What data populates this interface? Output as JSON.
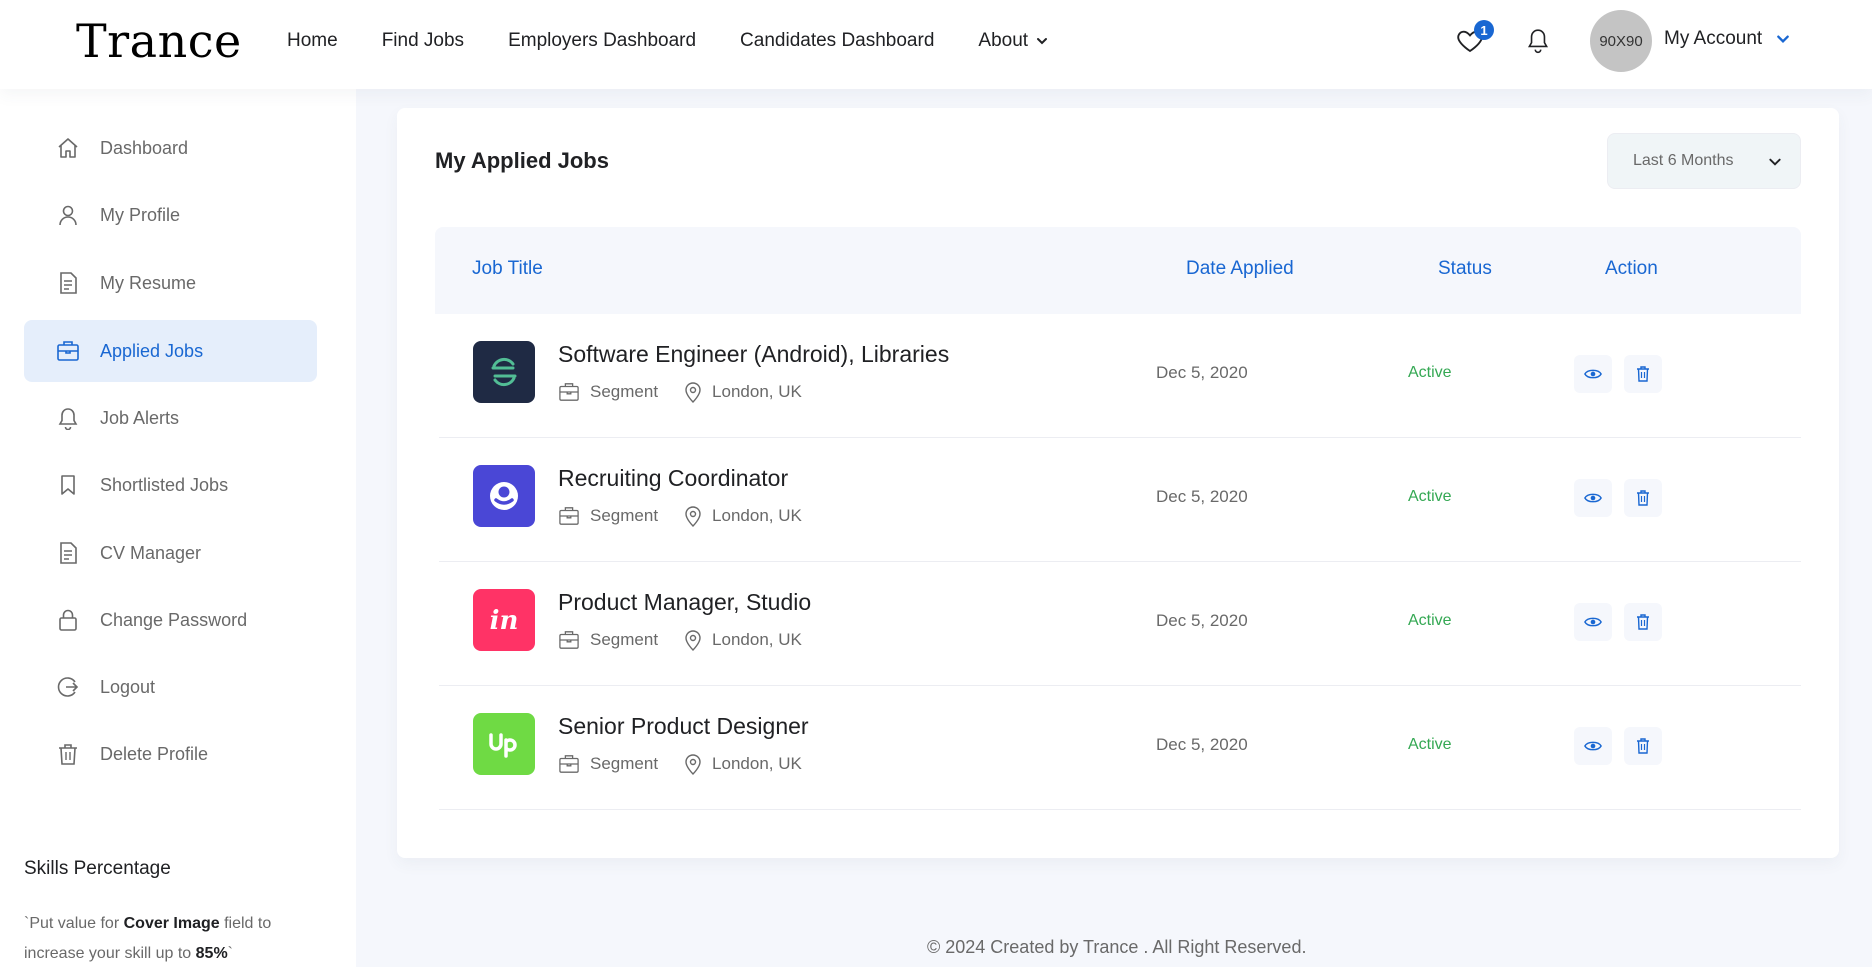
{
  "header": {
    "logo": "Trance",
    "nav": [
      {
        "label": "Home"
      },
      {
        "label": "Find Jobs"
      },
      {
        "label": "Employers Dashboard"
      },
      {
        "label": "Candidates Dashboard"
      },
      {
        "label": "About"
      }
    ],
    "wishlist_count": "1",
    "avatar_text": "90X90",
    "account_label": "My Account"
  },
  "sidebar": {
    "items": [
      {
        "label": "Dashboard",
        "icon": "home-icon"
      },
      {
        "label": "My Profile",
        "icon": "user-icon"
      },
      {
        "label": "My Resume",
        "icon": "document-icon"
      },
      {
        "label": "Applied Jobs",
        "icon": "briefcase-icon",
        "active": true
      },
      {
        "label": "Job Alerts",
        "icon": "bell-icon"
      },
      {
        "label": "Shortlisted Jobs",
        "icon": "bookmark-icon"
      },
      {
        "label": "CV Manager",
        "icon": "document-icon"
      },
      {
        "label": "Change Password",
        "icon": "lock-icon"
      },
      {
        "label": "Logout",
        "icon": "logout-icon"
      },
      {
        "label": "Delete Profile",
        "icon": "trash-icon"
      }
    ],
    "skills_title": "Skills Percentage",
    "skills_text_prefix": "`Put value for ",
    "skills_text_bold": "Cover Image",
    "skills_text_mid": " field to increase your skill up to ",
    "skills_text_pct": "85%",
    "skills_text_suffix": "`"
  },
  "main": {
    "title": "My Applied Jobs",
    "filter": "Last 6 Months",
    "columns": {
      "job_title": "Job Title",
      "date": "Date Applied",
      "status": "Status",
      "action": "Action"
    },
    "jobs": [
      {
        "title": "Software Engineer (Android), Libraries",
        "company": "Segment",
        "location": "London, UK",
        "date": "Dec 5, 2020",
        "status": "Active",
        "logo": "segment-logo",
        "logo_color": "#1f2a44"
      },
      {
        "title": "Recruiting Coordinator",
        "company": "Segment",
        "location": "London, UK",
        "date": "Dec 5, 2020",
        "status": "Active",
        "logo": "circle-logo",
        "logo_color": "#4a47d6"
      },
      {
        "title": "Product Manager, Studio",
        "company": "Segment",
        "location": "London, UK",
        "date": "Dec 5, 2020",
        "status": "Active",
        "logo": "invision-logo",
        "logo_color": "#ff3366"
      },
      {
        "title": "Senior Product Designer",
        "company": "Segment",
        "location": "London, UK",
        "date": "Dec 5, 2020",
        "status": "Active",
        "logo": "upwork-logo",
        "logo_color": "#6fda44"
      }
    ]
  },
  "footer": {
    "text": "© 2024 Created by Trance . All Right Reserved."
  },
  "colors": {
    "accent": "#1967d2",
    "status_active": "#34a853",
    "page_bg": "#f5f7fc"
  }
}
